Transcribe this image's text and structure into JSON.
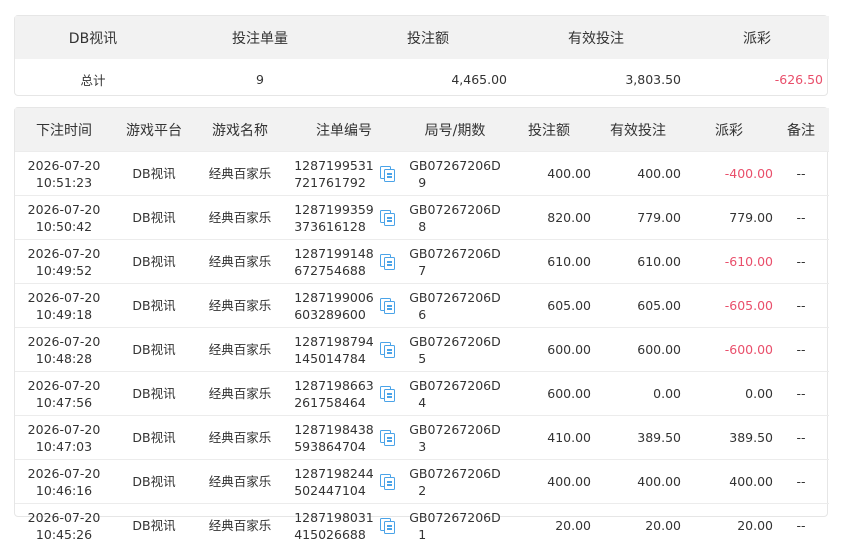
{
  "summary": {
    "headers": [
      "DB视讯",
      "投注单量",
      "投注额",
      "有效投注",
      "派彩"
    ],
    "total_label": "总计",
    "order_count": "9",
    "bet_amount": "4,465.00",
    "valid_bet": "3,803.50",
    "payout": "-626.50"
  },
  "records": {
    "headers": [
      "下注时间",
      "游戏平台",
      "游戏名称",
      "注单编号",
      "局号/期数",
      "投注额",
      "有效投注",
      "派彩",
      "备注"
    ],
    "rows": [
      {
        "date": "2026-07-20",
        "time": "10:51:23",
        "platform": "DB视讯",
        "game": "经典百家乐",
        "order_a": "1287199531",
        "order_b": "721761792",
        "round_a": "GB07267206D",
        "round_b": "9",
        "bet": "400.00",
        "valid": "400.00",
        "payout": "-400.00",
        "remark": "--"
      },
      {
        "date": "2026-07-20",
        "time": "10:50:42",
        "platform": "DB视讯",
        "game": "经典百家乐",
        "order_a": "1287199359",
        "order_b": "373616128",
        "round_a": "GB07267206D",
        "round_b": "8",
        "bet": "820.00",
        "valid": "779.00",
        "payout": "779.00",
        "remark": "--"
      },
      {
        "date": "2026-07-20",
        "time": "10:49:52",
        "platform": "DB视讯",
        "game": "经典百家乐",
        "order_a": "1287199148",
        "order_b": "672754688",
        "round_a": "GB07267206D",
        "round_b": "7",
        "bet": "610.00",
        "valid": "610.00",
        "payout": "-610.00",
        "remark": "--"
      },
      {
        "date": "2026-07-20",
        "time": "10:49:18",
        "platform": "DB视讯",
        "game": "经典百家乐",
        "order_a": "1287199006",
        "order_b": "603289600",
        "round_a": "GB07267206D",
        "round_b": "6",
        "bet": "605.00",
        "valid": "605.00",
        "payout": "-605.00",
        "remark": "--"
      },
      {
        "date": "2026-07-20",
        "time": "10:48:28",
        "platform": "DB视讯",
        "game": "经典百家乐",
        "order_a": "1287198794",
        "order_b": "145014784",
        "round_a": "GB07267206D",
        "round_b": "5",
        "bet": "600.00",
        "valid": "600.00",
        "payout": "-600.00",
        "remark": "--"
      },
      {
        "date": "2026-07-20",
        "time": "10:47:56",
        "platform": "DB视讯",
        "game": "经典百家乐",
        "order_a": "1287198663",
        "order_b": "261758464",
        "round_a": "GB07267206D",
        "round_b": "4",
        "bet": "600.00",
        "valid": "0.00",
        "payout": "0.00",
        "remark": "--"
      },
      {
        "date": "2026-07-20",
        "time": "10:47:03",
        "platform": "DB视讯",
        "game": "经典百家乐",
        "order_a": "1287198438",
        "order_b": "593864704",
        "round_a": "GB07267206D",
        "round_b": "3",
        "bet": "410.00",
        "valid": "389.50",
        "payout": "389.50",
        "remark": "--"
      },
      {
        "date": "2026-07-20",
        "time": "10:46:16",
        "platform": "DB视讯",
        "game": "经典百家乐",
        "order_a": "1287198244",
        "order_b": "502447104",
        "round_a": "GB07267206D",
        "round_b": "2",
        "bet": "400.00",
        "valid": "400.00",
        "payout": "400.00",
        "remark": "--"
      },
      {
        "date": "2026-07-20",
        "time": "10:45:26",
        "platform": "DB视讯",
        "game": "经典百家乐",
        "order_a": "1287198031",
        "order_b": "415026688",
        "round_a": "GB07267206D",
        "round_b": "1",
        "bet": "20.00",
        "valid": "20.00",
        "payout": "20.00",
        "remark": "--"
      }
    ]
  },
  "colors": {
    "negative": "#e94f6b",
    "header_bg": "#f2f2f2",
    "copy_icon": "#4aa3e8"
  },
  "icons": {
    "copy": "copy-icon"
  }
}
